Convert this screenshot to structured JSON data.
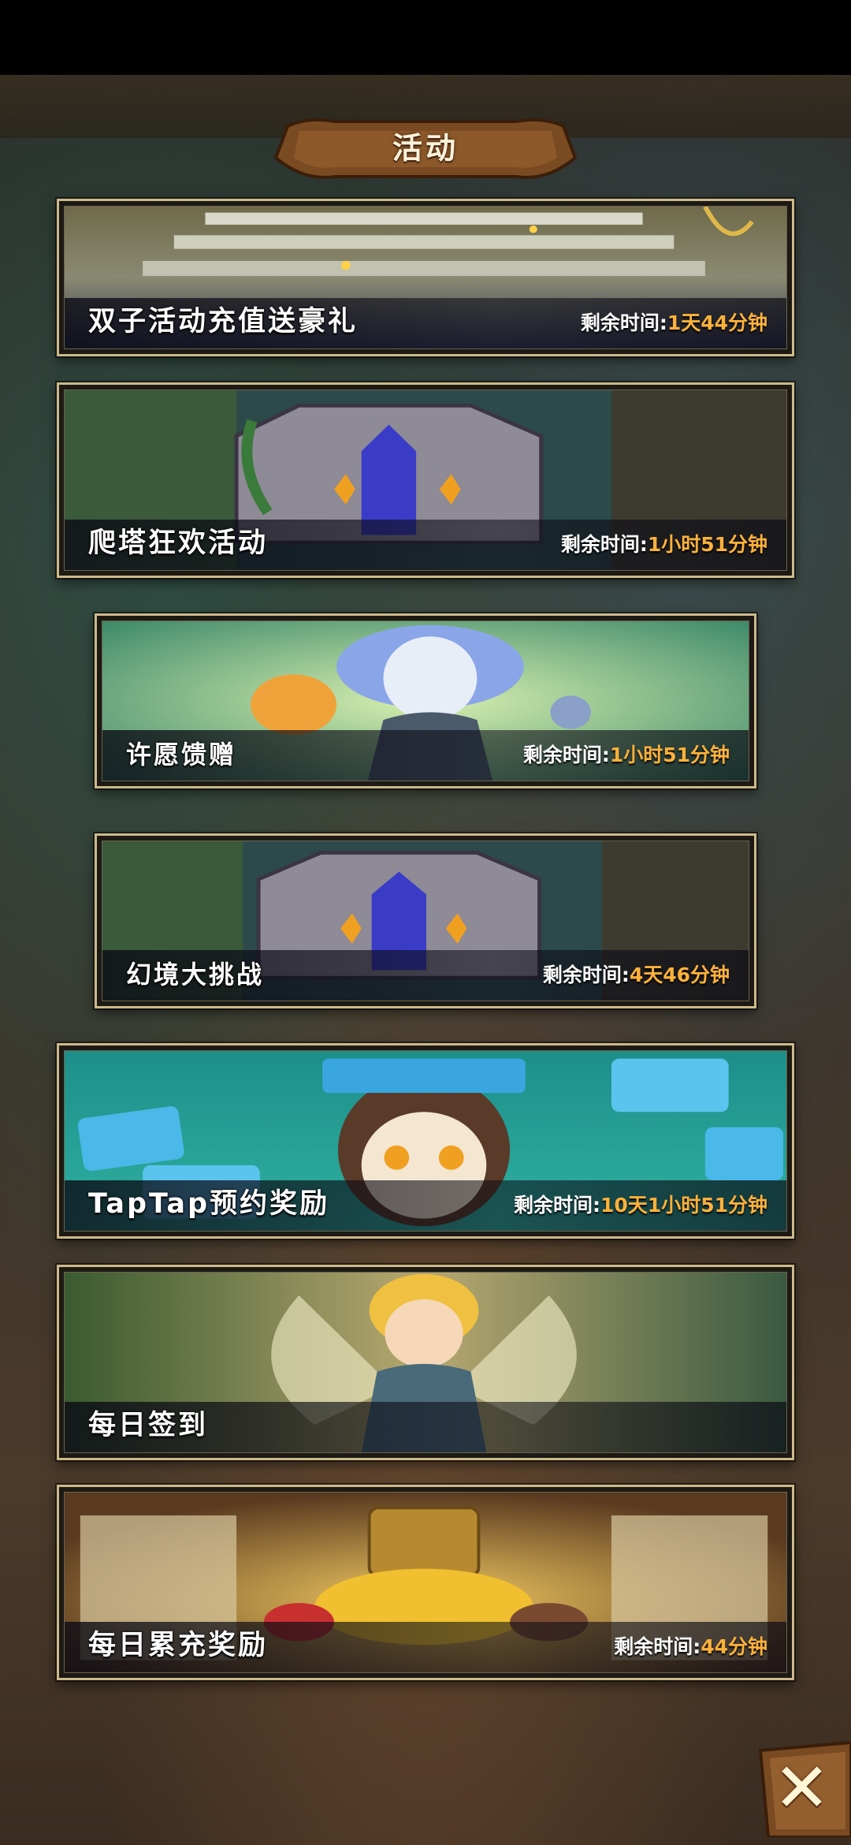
{
  "header": {
    "title": "活动"
  },
  "events": [
    {
      "name": "双子活动充值送豪礼",
      "timer_label": "剩余时间:",
      "timer_value": "1天44分钟"
    },
    {
      "name": "爬塔狂欢活动",
      "timer_label": "剩余时间:",
      "timer_value": "1小时51分钟"
    },
    {
      "name": "许愿馈赠",
      "timer_label": "剩余时间:",
      "timer_value": "1小时51分钟"
    },
    {
      "name": "幻境大挑战",
      "timer_label": "剩余时间:",
      "timer_value": "4天46分钟"
    },
    {
      "name": "TapTap预约奖励",
      "timer_label": "剩余时间:",
      "timer_value": "10天1小时51分钟"
    },
    {
      "name": "每日签到"
    },
    {
      "name": "每日累充奖励",
      "timer_label": "剩余时间:",
      "timer_value": "44分钟"
    }
  ],
  "close_button": {
    "icon": "close-icon",
    "glyph": "✕"
  },
  "colors": {
    "frame": "#cdb98a",
    "timer_value": "#ffb23a",
    "plaque": "#6b3e1c"
  }
}
